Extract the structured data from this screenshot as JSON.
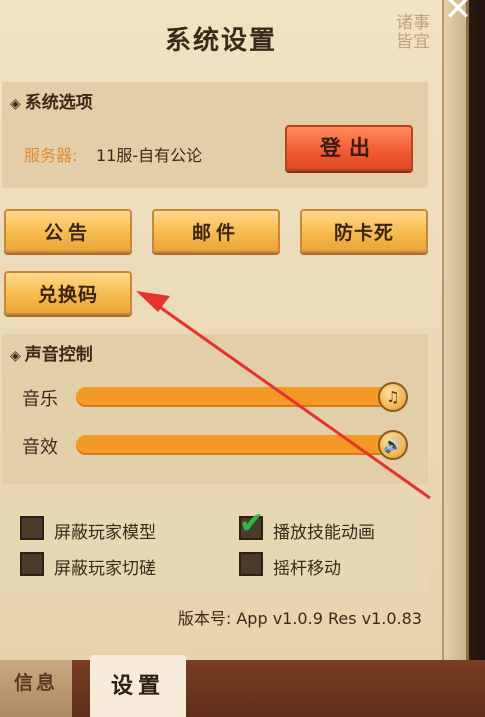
{
  "title": "系统设置",
  "corner_deco": "诸事\n皆宜",
  "system_options": {
    "title": "系统选项",
    "server_label": "服务器:",
    "server_value": "11服-自有公论",
    "logout_label": "登出"
  },
  "buttons": {
    "notice": "公告",
    "mail": "邮件",
    "anti_stuck": "防卡死",
    "redeem": "兑换码"
  },
  "sound": {
    "title": "声音控制",
    "music_label": "音乐",
    "music_level": 1.0,
    "music_icon": "music-note-icon",
    "sfx_label": "音效",
    "sfx_level": 1.0,
    "sfx_icon": "speaker-icon"
  },
  "options": [
    {
      "label": "屏蔽玩家模型",
      "checked": false
    },
    {
      "label": "播放技能动画",
      "checked": true
    },
    {
      "label": "屏蔽玩家切磋",
      "checked": false
    },
    {
      "label": "摇杆移动",
      "checked": false
    }
  ],
  "version": "版本号: App v1.0.9 Res v1.0.83",
  "tabs": {
    "info": "信息",
    "settings": "设置"
  },
  "colors": {
    "accent_orange": "#f39a26",
    "logout_red": "#f05a33",
    "annotation_arrow": "#e8322e",
    "check_green": "#2fb84a"
  }
}
